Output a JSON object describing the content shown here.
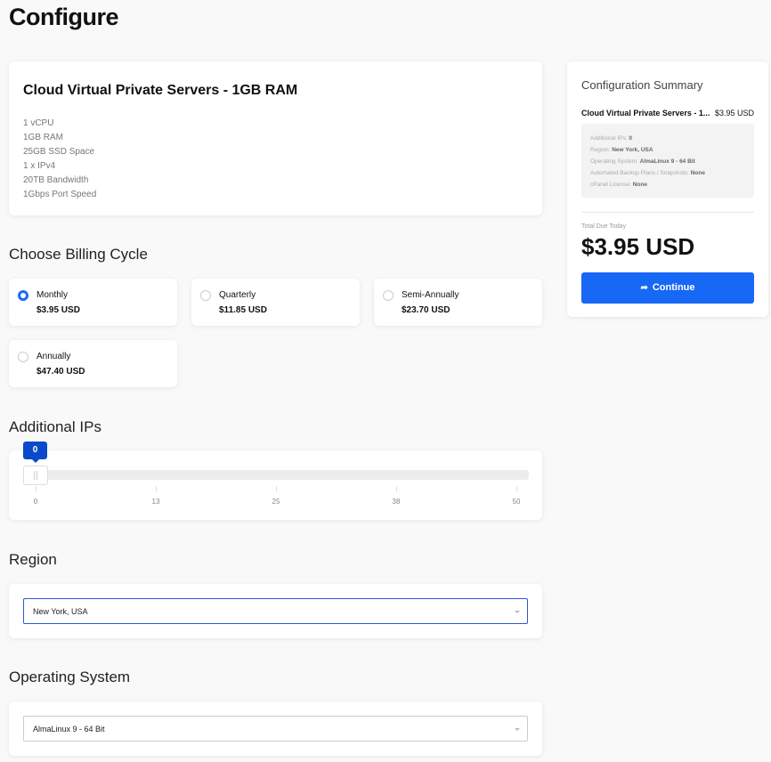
{
  "page": {
    "title": "Configure"
  },
  "product": {
    "name": "Cloud Virtual Private Servers - 1GB RAM",
    "specs": [
      "1 vCPU",
      "1GB RAM",
      "25GB SSD Space",
      "1 x IPv4",
      "20TB Bandwidth",
      "1Gbps Port Speed"
    ]
  },
  "billing": {
    "title": "Choose Billing Cycle",
    "options": [
      {
        "name": "Monthly",
        "price": "$3.95 USD",
        "selected": true
      },
      {
        "name": "Quarterly",
        "price": "$11.85 USD",
        "selected": false
      },
      {
        "name": "Semi-Annually",
        "price": "$23.70 USD",
        "selected": false
      },
      {
        "name": "Annually",
        "price": "$47.40 USD",
        "selected": false
      }
    ]
  },
  "additional_ips": {
    "title": "Additional IPs",
    "value": "0",
    "ticks": [
      "0",
      "13",
      "25",
      "38",
      "50"
    ]
  },
  "region": {
    "title": "Region",
    "selected": "New York, USA"
  },
  "os": {
    "title": "Operating System",
    "selected": "AlmaLinux 9 - 64 Bit"
  },
  "summary": {
    "title": "Configuration Summary",
    "product": "Cloud Virtual Private Servers - 1...",
    "price": "$3.95 USD",
    "details": [
      {
        "label": "Additional IPs: ",
        "value": "0"
      },
      {
        "label": "Region: ",
        "value": "New York, USA"
      },
      {
        "label": "Operating System: ",
        "value": "AlmaLinux 9 - 64 Bit"
      },
      {
        "label": "Automated Backup Plans / Snapshots: ",
        "value": "None"
      },
      {
        "label": "cPanel License: ",
        "value": "None"
      }
    ],
    "total_label": "Total Due Today",
    "total": "$3.95 USD",
    "continue_label": "Continue"
  },
  "colors": {
    "accent": "#1668f5",
    "bubble": "#0a49c9"
  },
  "icons": {
    "continue": "share-arrow-icon"
  }
}
